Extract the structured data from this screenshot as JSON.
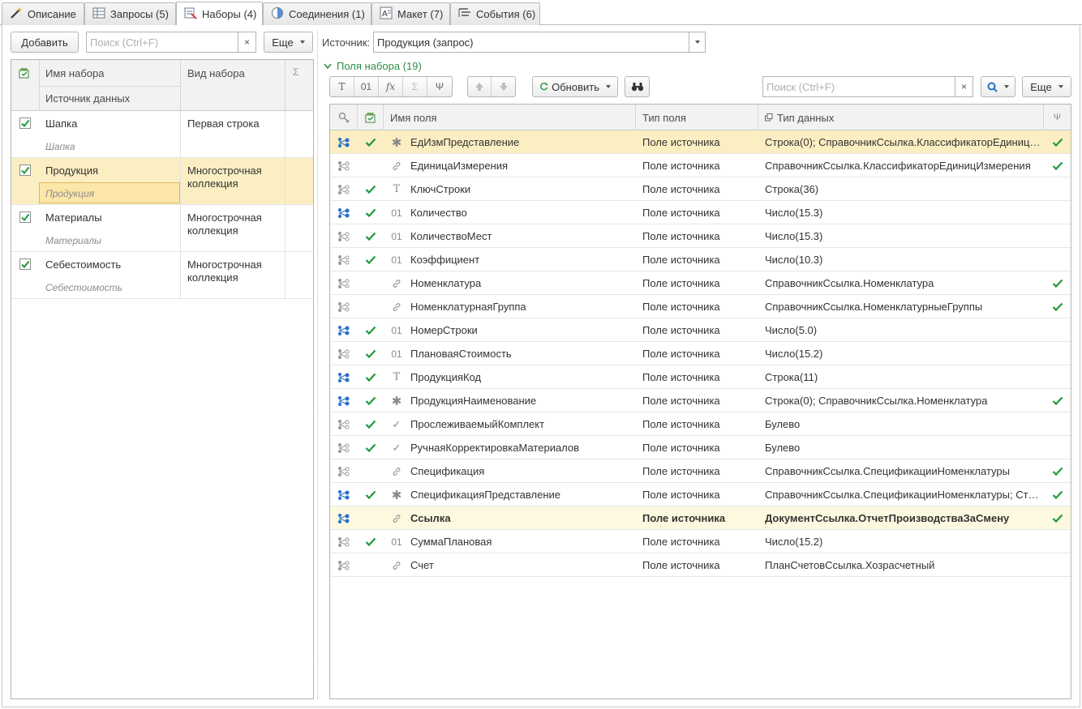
{
  "tabs": [
    {
      "label": "Описание",
      "icon": "wand-icon"
    },
    {
      "label": "Запросы (5)",
      "icon": "table-icon"
    },
    {
      "label": "Наборы (4)",
      "icon": "dataset-icon",
      "active": true
    },
    {
      "label": "Соединения (1)",
      "icon": "link-circle-icon"
    },
    {
      "label": "Макет (7)",
      "icon": "layout-icon"
    },
    {
      "label": "События (6)",
      "icon": "events-icon"
    }
  ],
  "left": {
    "add_label": "Добавить",
    "search_placeholder": "Поиск (Ctrl+F)",
    "clear_symbol": "×",
    "more_label": "Еще",
    "columns": {
      "name": "Имя набора",
      "source": "Источник данных",
      "kind": "Вид набора"
    },
    "rows": [
      {
        "name": "Шапка",
        "source": "Шапка",
        "kind": "Первая строка",
        "checked": true
      },
      {
        "name": "Продукция",
        "source": "Продукция",
        "kind": "Многострочная коллекция",
        "checked": true,
        "selected": true
      },
      {
        "name": "Материалы",
        "source": "Материалы",
        "kind": "Многострочная коллекция",
        "checked": true
      },
      {
        "name": "Себестоимость",
        "source": "Себестоимость",
        "kind": "Многострочная коллекция",
        "checked": true
      }
    ]
  },
  "right": {
    "source_label": "Источник:",
    "source_value": "Продукция (запрос)",
    "group_title": "Поля набора (19)",
    "toolbar": {
      "text_btn": "T",
      "num_btn": "01",
      "fx_btn": "fx",
      "refresh_label": "Обновить",
      "search_placeholder": "Поиск (Ctrl+F)",
      "clear_symbol": "×",
      "more_label": "Еще"
    },
    "columns": {
      "field_name": "Имя поля",
      "field_type": "Тип поля",
      "data_type": "Тип данных"
    },
    "rows": [
      {
        "name": "ЕдИзмПредставление",
        "ftype": "Поле источника",
        "dtype": "Строка(0); СправочникСсылка.КлассификаторЕдиниц…",
        "kind": "star",
        "blue": true,
        "check": true,
        "last": true,
        "selected": true
      },
      {
        "name": "ЕдиницаИзмерения",
        "ftype": "Поле источника",
        "dtype": "СправочникСсылка.КлассификаторЕдиницИзмерения",
        "kind": "link",
        "blue": false,
        "check": false,
        "last": true
      },
      {
        "name": "КлючСтроки",
        "ftype": "Поле источника",
        "dtype": "Строка(36)",
        "kind": "text",
        "blue": false,
        "check": true,
        "last": false
      },
      {
        "name": "Количество",
        "ftype": "Поле источника",
        "dtype": "Число(15.3)",
        "kind": "num",
        "blue": true,
        "check": true,
        "last": false
      },
      {
        "name": "КоличествоМест",
        "ftype": "Поле источника",
        "dtype": "Число(15.3)",
        "kind": "num",
        "blue": false,
        "check": true,
        "last": false
      },
      {
        "name": "Коэффициент",
        "ftype": "Поле источника",
        "dtype": "Число(10.3)",
        "kind": "num",
        "blue": false,
        "check": true,
        "last": false
      },
      {
        "name": "Номенклатура",
        "ftype": "Поле источника",
        "dtype": "СправочникСсылка.Номенклатура",
        "kind": "link",
        "blue": false,
        "check": false,
        "last": true
      },
      {
        "name": "НоменклатурнаяГруппа",
        "ftype": "Поле источника",
        "dtype": "СправочникСсылка.НоменклатурныеГруппы",
        "kind": "link",
        "blue": false,
        "check": false,
        "last": true
      },
      {
        "name": "НомерСтроки",
        "ftype": "Поле источника",
        "dtype": "Число(5.0)",
        "kind": "num",
        "blue": true,
        "check": true,
        "last": false
      },
      {
        "name": "ПлановаяСтоимость",
        "ftype": "Поле источника",
        "dtype": "Число(15.2)",
        "kind": "num",
        "blue": false,
        "check": true,
        "last": false
      },
      {
        "name": "ПродукцияКод",
        "ftype": "Поле источника",
        "dtype": "Строка(11)",
        "kind": "text",
        "blue": true,
        "check": true,
        "last": false
      },
      {
        "name": "ПродукцияНаименование",
        "ftype": "Поле источника",
        "dtype": "Строка(0); СправочникСсылка.Номенклатура",
        "kind": "star",
        "blue": true,
        "check": true,
        "last": true
      },
      {
        "name": "ПрослеживаемыйКомплект",
        "ftype": "Поле источника",
        "dtype": "Булево",
        "kind": "bool",
        "blue": false,
        "check": true,
        "last": false
      },
      {
        "name": "РучнаяКорректировкаМатериалов",
        "ftype": "Поле источника",
        "dtype": "Булево",
        "kind": "bool",
        "blue": false,
        "check": true,
        "last": false
      },
      {
        "name": "Спецификация",
        "ftype": "Поле источника",
        "dtype": "СправочникСсылка.СпецификацииНоменклатуры",
        "kind": "link",
        "blue": false,
        "check": false,
        "last": true
      },
      {
        "name": "СпецификацияПредставление",
        "ftype": "Поле источника",
        "dtype": "СправочникСсылка.СпецификацииНоменклатуры; Ст…",
        "kind": "star",
        "blue": true,
        "check": true,
        "last": true
      },
      {
        "name": "Ссылка",
        "ftype": "Поле источника",
        "dtype": "ДокументСсылка.ОтчетПроизводстваЗаСмену",
        "kind": "link",
        "blue": true,
        "check": false,
        "last": true,
        "bold": true
      },
      {
        "name": "СуммаПлановая",
        "ftype": "Поле источника",
        "dtype": "Число(15.2)",
        "kind": "num",
        "blue": false,
        "check": true,
        "last": false
      },
      {
        "name": "Счет",
        "ftype": "Поле источника",
        "dtype": "ПланСчетовСсылка.Хозрасчетный",
        "kind": "link",
        "blue": false,
        "check": false,
        "last": false
      }
    ]
  },
  "colors": {
    "accent_green": "#1f9a3a",
    "selected_row": "#fbeec2",
    "group_title": "#2f8f46",
    "struct_blue": "#2a6fc9"
  }
}
